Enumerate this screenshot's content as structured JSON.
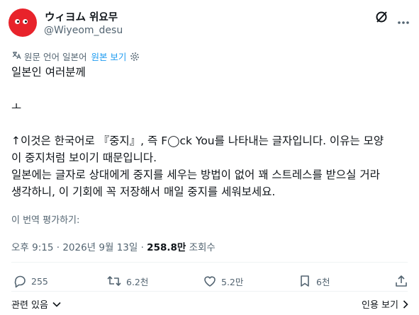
{
  "author": {
    "display_name": "ウィヨム 위요무",
    "handle": "@Wiyeom_desu"
  },
  "language_bar": {
    "original_language": "원문 언어 일본어",
    "view_original": "원본 보기"
  },
  "post": {
    "line1": "일본인 여러분께",
    "line2": "ㅗ",
    "line3": "↑이것은 한국어로 『중지』, 즉 F◯ck You를 나타내는 글자입니다. 이유는 모양",
    "line4": "이 중지처럼 보이기 때문입니다.",
    "line5": "일본에는 글자로 상대에게 중지를 세우는 방법이 없어 꽤 스트레스를 받으실 거라",
    "line6": "생각하니, 이 기회에 꼭 저장해서 매일 중지를 세워보세요."
  },
  "rate_translation": "이 번역 평가하기:",
  "meta": {
    "time": "오후 9:15 · 2026년 9월 13일 · ",
    "views_count": "258.8만",
    "views_label": " 조회수"
  },
  "actions": {
    "replies": "255",
    "reposts": "6.2천",
    "likes": "5.2만",
    "bookmarks": "6천"
  },
  "footer": {
    "related": "관련 있음",
    "quotes": "인용 보기"
  }
}
